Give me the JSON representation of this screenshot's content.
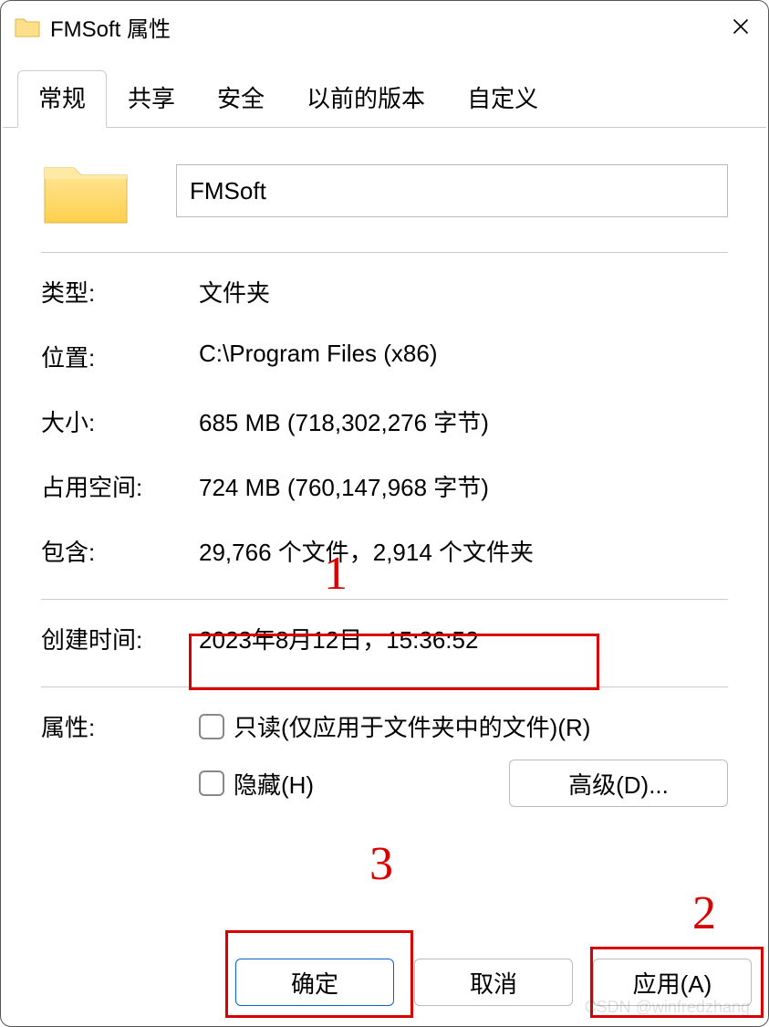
{
  "title": "FMSoft 属性",
  "tabs": [
    "常规",
    "共享",
    "安全",
    "以前的版本",
    "自定义"
  ],
  "active_tab": 0,
  "folder_name": "FMSoft",
  "rows": {
    "type_label": "类型:",
    "type_value": "文件夹",
    "location_label": "位置:",
    "location_value": "C:\\Program Files (x86)",
    "size_label": "大小:",
    "size_value": "685 MB (718,302,276 字节)",
    "sizeondisk_label": "占用空间:",
    "sizeondisk_value": "724 MB (760,147,968 字节)",
    "contains_label": "包含:",
    "contains_value": "29,766 个文件，2,914 个文件夹",
    "created_label": "创建时间:",
    "created_value": "2023年8月12日，15:36:52",
    "attributes_label": "属性:"
  },
  "attributes": {
    "readonly_label": "只读(仅应用于文件夹中的文件)(R)",
    "readonly_checked": false,
    "hidden_label": "隐藏(H)",
    "hidden_checked": false,
    "advanced_label": "高级(D)..."
  },
  "buttons": {
    "ok": "确定",
    "cancel": "取消",
    "apply": "应用(A)"
  },
  "annotations": {
    "n1": "1",
    "n2": "2",
    "n3": "3"
  },
  "watermark": "CSDN @winfredzhang"
}
